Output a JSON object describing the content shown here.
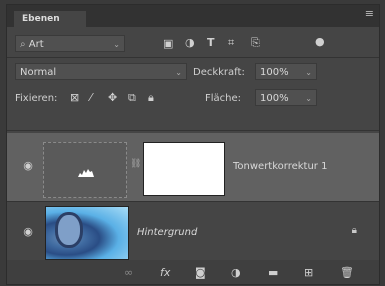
{
  "panel": {
    "tab_title": "Ebenen",
    "menu_icon": "hamburger-icon"
  },
  "filter": {
    "kind_label": "Art",
    "icons": [
      "image-icon",
      "adjustment-circle-icon",
      "type-icon",
      "transform-icon",
      "smartobject-icon"
    ]
  },
  "blend": {
    "mode": "Normal",
    "opacity_label": "Deckkraft:",
    "opacity_value": "100%"
  },
  "lock": {
    "label": "Fixieren:",
    "fill_label": "Fläche:",
    "fill_value": "100%"
  },
  "layers": [
    {
      "name": "Tonwertkorrektur 1",
      "selected": true
    },
    {
      "name": "Hintergrund",
      "italic": true
    }
  ],
  "bottom_icons": [
    "link-icon",
    "fx-icon",
    "mask-icon",
    "adjustment-icon",
    "folder-icon",
    "new-layer-icon",
    "trash-icon"
  ]
}
